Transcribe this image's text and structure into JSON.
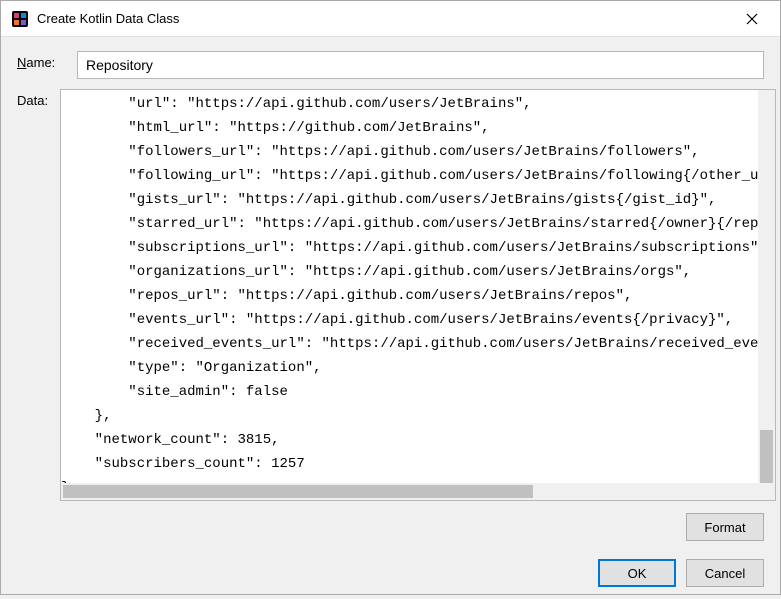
{
  "titlebar": {
    "title": "Create Kotlin Data Class"
  },
  "form": {
    "name_label_first": "N",
    "name_label_rest": "ame:",
    "data_label": "Data:",
    "name_value": "Repository"
  },
  "buttons": {
    "format": "Format",
    "ok": "OK",
    "cancel": "Cancel"
  },
  "json_lines": [
    "        \"url\": \"https://api.github.com/users/JetBrains\",",
    "        \"html_url\": \"https://github.com/JetBrains\",",
    "        \"followers_url\": \"https://api.github.com/users/JetBrains/followers\",",
    "        \"following_url\": \"https://api.github.com/users/JetBrains/following{/other_use",
    "        \"gists_url\": \"https://api.github.com/users/JetBrains/gists{/gist_id}\",",
    "        \"starred_url\": \"https://api.github.com/users/JetBrains/starred{/owner}{/repo}",
    "        \"subscriptions_url\": \"https://api.github.com/users/JetBrains/subscriptions\",",
    "        \"organizations_url\": \"https://api.github.com/users/JetBrains/orgs\",",
    "        \"repos_url\": \"https://api.github.com/users/JetBrains/repos\",",
    "        \"events_url\": \"https://api.github.com/users/JetBrains/events{/privacy}\",",
    "        \"received_events_url\": \"https://api.github.com/users/JetBrains/received_event",
    "        \"type\": \"Organization\",",
    "        \"site_admin\": false",
    "    },",
    "    \"network_count\": 3815,",
    "    \"subscribers_count\": 1257",
    "}"
  ]
}
